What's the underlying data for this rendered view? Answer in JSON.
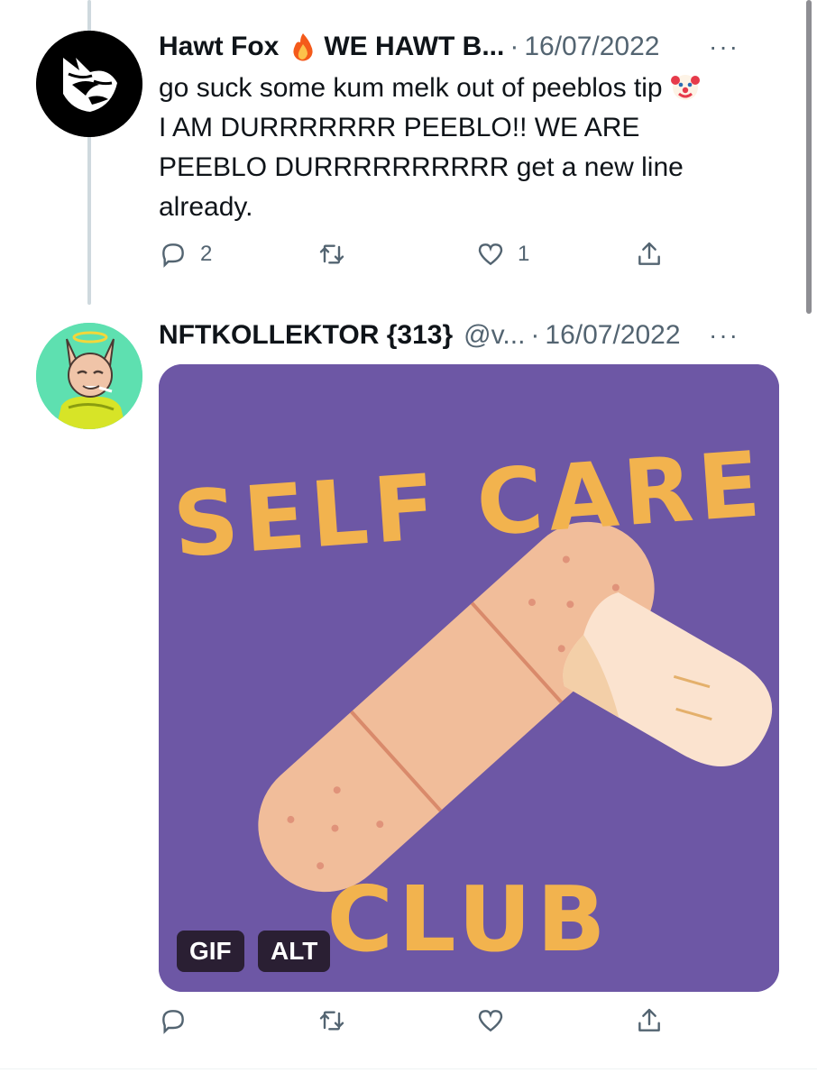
{
  "tweets": [
    {
      "author": {
        "name": "Hawt Fox",
        "name_suffix": "WE HAWT B...",
        "avatar": "fox-logo-avatar"
      },
      "date": "16/07/2022",
      "text_lines": [
        "go suck some kum melk out of peeblos tip",
        "I AM DURRRRRRR PEEBLO!! WE ARE",
        "PEEBLO DURRRRRRRRRR get a new line",
        "already."
      ],
      "reply_count": "2",
      "like_count": "1"
    },
    {
      "author": {
        "name": "NFTKOLLEKTOR {313}",
        "handle": "@v...",
        "avatar": "cat-with-halo-avatar"
      },
      "date": "16/07/2022",
      "media": {
        "line1": "SELF CARE",
        "line2": "CLUB",
        "gif_badge": "GIF",
        "alt_badge": "ALT"
      }
    }
  ],
  "icons": {
    "reply": "reply-icon",
    "retweet": "retweet-icon",
    "like": "heart-icon",
    "share": "share-icon",
    "more": "more-icon",
    "emoji_fire": "fire-emoji",
    "emoji_clown": "clown-emoji"
  },
  "colors": {
    "secondary_text": "#536471",
    "media_background": "#6d57a5",
    "media_lettering": "#f2b34e",
    "thread_line": "#cfd9de"
  }
}
